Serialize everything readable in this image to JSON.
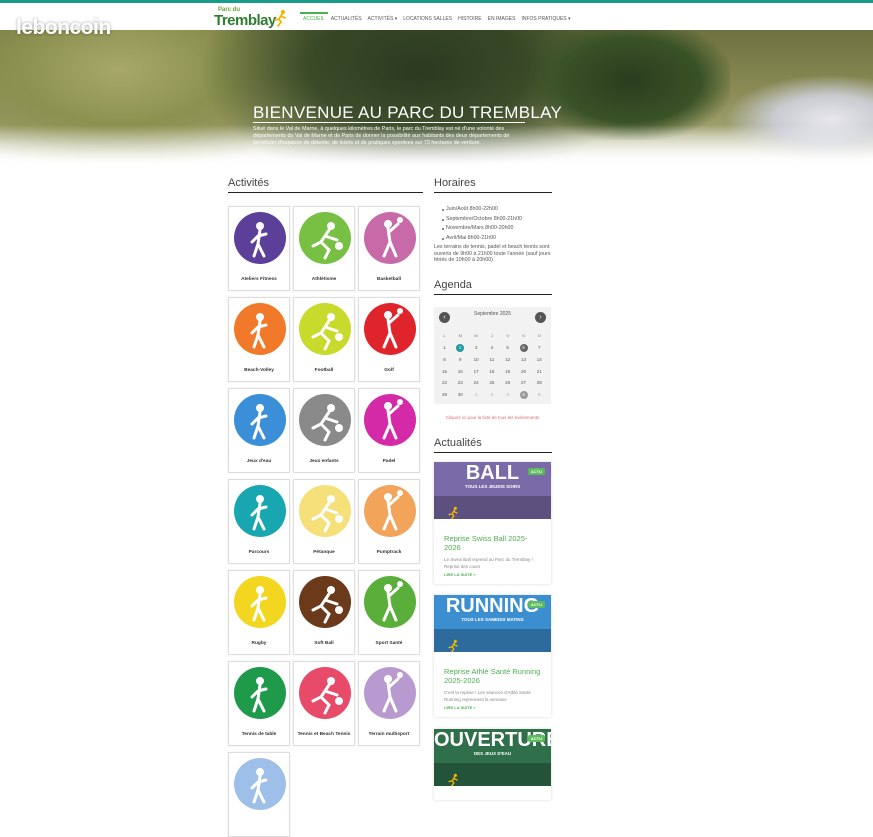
{
  "watermark": "leboncoin",
  "logo": {
    "small": "Parc du",
    "big": "Tremblay",
    "tagline": ""
  },
  "nav": [
    {
      "label": "ACCUEIL",
      "active": true,
      "dropdown": false
    },
    {
      "label": "ACTUALITÉS",
      "active": false,
      "dropdown": false
    },
    {
      "label": "ACTIVITÉS",
      "active": false,
      "dropdown": true
    },
    {
      "label": "LOCATIONS SALLES",
      "active": false,
      "dropdown": false
    },
    {
      "label": "HISTOIRE",
      "active": false,
      "dropdown": false
    },
    {
      "label": "EN IMAGES",
      "active": false,
      "dropdown": false
    },
    {
      "label": "INFOS PRATIQUES",
      "active": false,
      "dropdown": true
    }
  ],
  "hero": {
    "title": "BIENVENUE AU PARC DU TREMBLAY",
    "text": "Situé dans le Val de Marne, à quelques kilomètres de Paris, le parc du Tremblay est né d'une volonté des départements du Val de Marne et de Paris de donner la possibilité aux habitants des deux départements de bénéficier d'espaces de détente, de loisirs et de pratiques sportives sur 73 hectares de verdure."
  },
  "activities": {
    "title": "Activités",
    "items": [
      {
        "label": "Ateliers Fitness",
        "color": "#5b3f99",
        "icon": "fitness-icon"
      },
      {
        "label": "Athlétisme",
        "color": "#78c043",
        "icon": "athletics-icon"
      },
      {
        "label": "Basketball",
        "color": "#c86aa8",
        "icon": "basketball-icon"
      },
      {
        "label": "Beach-Volley",
        "color": "#f07a2a",
        "icon": "beach-volley-icon"
      },
      {
        "label": "Football",
        "color": "#c8da2c",
        "icon": "football-icon"
      },
      {
        "label": "Golf",
        "color": "#e0242c",
        "icon": "golf-icon"
      },
      {
        "label": "Jeux d'eau",
        "color": "#3a8fd8",
        "icon": "water-games-icon"
      },
      {
        "label": "Jeux enfants",
        "color": "#8a8a8a",
        "icon": "playground-icon"
      },
      {
        "label": "Padel",
        "color": "#d42aa8",
        "icon": "padel-icon"
      },
      {
        "label": "Parcours",
        "color": "#18a6b0",
        "icon": "archery-target-icon"
      },
      {
        "label": "Pétanque",
        "color": "#f5e07a",
        "icon": "petanque-icon"
      },
      {
        "label": "Pumptrack",
        "color": "#f2a45a",
        "icon": "pumptrack-icon"
      },
      {
        "label": "Rugby",
        "color": "#f2d620",
        "icon": "rugby-icon"
      },
      {
        "label": "Soft Ball",
        "color": "#6a3a1a",
        "icon": "softball-icon"
      },
      {
        "label": "Sport Santé",
        "color": "#5aae3a",
        "icon": "sport-health-icon"
      },
      {
        "label": "Tennis de table",
        "color": "#1f9a4a",
        "icon": "table-tennis-icon"
      },
      {
        "label": "Tennis et Beach Tennis",
        "color": "#e84a6a",
        "icon": "tennis-icon"
      },
      {
        "label": "Terrain multisport",
        "color": "#b89ad0",
        "icon": "multisport-icon"
      },
      {
        "label": "",
        "color": "#9ec0e8",
        "icon": "archery-icon"
      }
    ]
  },
  "horaires": {
    "title": "Horaires",
    "list": [
      "Juin/Août 8h00-22h00",
      "Septembre/Octobre 8h00-21h00",
      "Novembre/Mars 8h00-20h00",
      "Avril/Mai 8h00-21h00"
    ],
    "note": "Les terrains de tennis, padel et beach tennis sont ouverts de 9h00 à 21h00 toute l'année (sauf jours fériés de 10h00 à 20h00)"
  },
  "agenda": {
    "title": "Agenda",
    "month": "Septembre 2025",
    "prev": "‹",
    "next": "›",
    "dow": [
      "L",
      "M",
      "M",
      "J",
      "V",
      "S",
      "D"
    ],
    "weeks": [
      [
        {
          "d": "1"
        },
        {
          "d": "2",
          "s": "today"
        },
        {
          "d": "3"
        },
        {
          "d": "4"
        },
        {
          "d": "5"
        },
        {
          "d": "6",
          "s": "dot"
        },
        {
          "d": "7"
        }
      ],
      [
        {
          "d": "8"
        },
        {
          "d": "9"
        },
        {
          "d": "10"
        },
        {
          "d": "11"
        },
        {
          "d": "12"
        },
        {
          "d": "13"
        },
        {
          "d": "14"
        }
      ],
      [
        {
          "d": "15"
        },
        {
          "d": "16"
        },
        {
          "d": "17"
        },
        {
          "d": "18"
        },
        {
          "d": "19"
        },
        {
          "d": "20"
        },
        {
          "d": "21"
        }
      ],
      [
        {
          "d": "22"
        },
        {
          "d": "23"
        },
        {
          "d": "24"
        },
        {
          "d": "25"
        },
        {
          "d": "26"
        },
        {
          "d": "27"
        },
        {
          "d": "28"
        }
      ],
      [
        {
          "d": "29"
        },
        {
          "d": "30"
        },
        {
          "d": "1",
          "s": "muted"
        },
        {
          "d": "2",
          "s": "muted"
        },
        {
          "d": "3",
          "s": "muted"
        },
        {
          "d": "4",
          "s": "dot-light"
        },
        {
          "d": "5",
          "s": "muted"
        }
      ]
    ],
    "link": "Cliquez ici pour la liste de tous les événements"
  },
  "news": {
    "title": "Actualités",
    "items": [
      {
        "banner_text": "BALL",
        "banner_sub": "TOUS LES JEUDIS SOIRS",
        "banner_color": "#7a6aa8",
        "badge": "ACTU",
        "title": "Reprise Swiss Ball 2025-2026",
        "desc": "Le Swiss Ball reprend au Parc du Tremblay ! Reprise des cours",
        "more": "LIRE LA SUITE »"
      },
      {
        "banner_text": "RUNNING",
        "banner_sub": "TOUS LES SAMEDIS MATINS",
        "banner_color": "#3b8fd0",
        "badge": "ACTU",
        "title": "Reprise Athlé Santé Running 2025-2026",
        "desc": "C'est la reprise ! Les séances d'Athlé Santé Running reprennent la semaine",
        "more": "LIRE LA SUITE »"
      },
      {
        "banner_text": "OUVERTURE",
        "banner_sub": "DES JEUX D'EAU",
        "banner_color": "#2f6f4a",
        "badge": "ACTU",
        "title": "",
        "desc": "",
        "more": ""
      }
    ]
  }
}
